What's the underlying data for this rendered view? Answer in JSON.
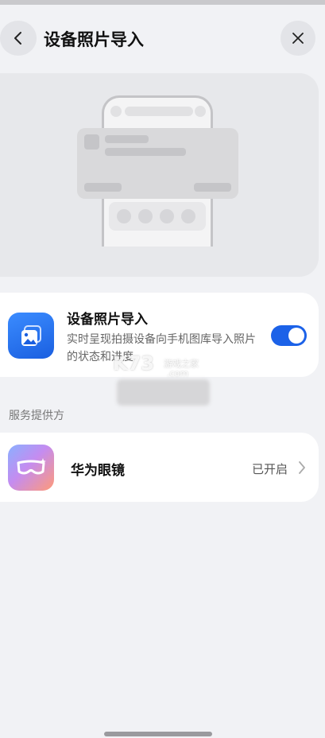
{
  "header": {
    "title": "设备照片导入",
    "back_icon": "chevron-left-icon",
    "close_icon": "close-icon"
  },
  "feature": {
    "title": "设备照片导入",
    "description": "实时呈现拍摄设备向手机图库导入照片的状态和进度",
    "toggle_on": true,
    "accent_color": "#1c62e8",
    "icon": "photo-gallery-icon"
  },
  "watermark": {
    "text": "K73",
    "subtext": "游戏之家",
    "domain": ".com"
  },
  "services": {
    "section_label": "服务提供方",
    "provider": {
      "name": "华为眼镜",
      "status": "已开启",
      "icon": "glasses-icon"
    }
  }
}
